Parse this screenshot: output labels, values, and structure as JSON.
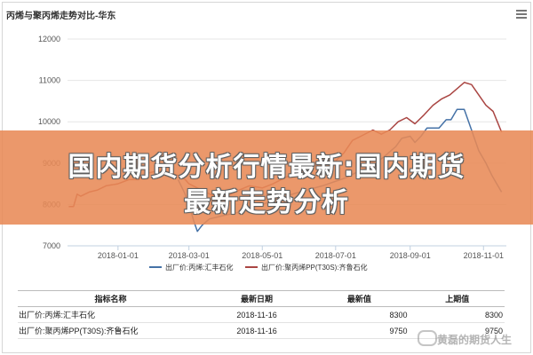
{
  "page": {
    "title": "丙烯与聚丙烯走势对比-华东",
    "banner_line1": "国内期货分析行情最新:国内期货",
    "banner_line2": "最新走势分析",
    "watermark": "黄磊的期货人生"
  },
  "colors": {
    "series1": "#4572a7",
    "series2": "#aa4643",
    "grid": "#e6e6e6",
    "banner": "#e88a56"
  },
  "chart_data": {
    "type": "line",
    "title": "丙烯与聚丙烯走势对比-华东",
    "xlabel": "",
    "ylabel": "",
    "ylim": [
      7000,
      12000
    ],
    "yticks": [
      "12000",
      "11000",
      "10000",
      "9000",
      "8000",
      "7000"
    ],
    "xticks": [
      "2018-01-01",
      "2018-03-01",
      "2018-05-01",
      "2018-07-01",
      "2018-09-01",
      "2018-11-01"
    ],
    "xrange": [
      "2017-11-20",
      "2018-11-20"
    ],
    "grid": true,
    "legend_position": "bottom",
    "series": [
      {
        "name": "出厂价:丙烯:汇丰石化",
        "points": [
          [
            "2018-02-20",
            8600
          ],
          [
            "2018-02-25",
            8300
          ],
          [
            "2018-03-01",
            8000
          ],
          [
            "2018-03-05",
            7600
          ],
          [
            "2018-03-08",
            7350
          ],
          [
            "2018-03-12",
            7500
          ],
          [
            "2018-03-18",
            7650
          ],
          [
            "2018-03-25",
            7700
          ],
          [
            "2018-04-01",
            7750
          ],
          [
            "2018-04-10",
            7800
          ],
          [
            "2018-04-20",
            7900
          ],
          [
            "2018-05-01",
            8000
          ],
          [
            "2018-05-15",
            8150
          ],
          [
            "2018-06-01",
            8300
          ],
          [
            "2018-06-20",
            8450
          ],
          [
            "2018-07-10",
            8650
          ],
          [
            "2018-07-20",
            8800
          ],
          [
            "2018-08-01",
            8950
          ],
          [
            "2018-08-10",
            9150
          ],
          [
            "2018-08-20",
            9400
          ],
          [
            "2018-08-25",
            9600
          ],
          [
            "2018-09-01",
            9650
          ],
          [
            "2018-09-05",
            9500
          ],
          [
            "2018-09-10",
            9650
          ],
          [
            "2018-09-15",
            9850
          ],
          [
            "2018-09-25",
            9850
          ],
          [
            "2018-10-01",
            10050
          ],
          [
            "2018-10-05",
            10050
          ],
          [
            "2018-10-10",
            10300
          ],
          [
            "2018-10-16",
            10300
          ],
          [
            "2018-10-22",
            9800
          ],
          [
            "2018-10-28",
            9300
          ],
          [
            "2018-11-03",
            9000
          ],
          [
            "2018-11-08",
            8700
          ],
          [
            "2018-11-12",
            8500
          ],
          [
            "2018-11-16",
            8300
          ]
        ]
      },
      {
        "name": "出厂价:聚丙烯PP(T30S):齐鲁石化",
        "points": [
          [
            "2017-11-21",
            7950
          ],
          [
            "2017-11-25",
            7950
          ],
          [
            "2017-11-28",
            8250
          ],
          [
            "2017-12-01",
            8200
          ],
          [
            "2017-12-08",
            8300
          ],
          [
            "2017-12-15",
            8350
          ],
          [
            "2017-12-22",
            8450
          ],
          [
            "2018-01-01",
            8500
          ],
          [
            "2018-01-10",
            8600
          ],
          [
            "2018-01-18",
            8600
          ],
          [
            "2018-01-25",
            8750
          ],
          [
            "2018-02-01",
            8800
          ],
          [
            "2018-02-10",
            8800
          ],
          [
            "2018-02-20",
            8700
          ],
          [
            "2018-02-26",
            8600
          ],
          [
            "2018-03-01",
            8500
          ],
          [
            "2018-03-08",
            8400
          ],
          [
            "2018-03-15",
            8300
          ],
          [
            "2018-03-22",
            8200
          ],
          [
            "2018-04-01",
            8200
          ],
          [
            "2018-04-12",
            8350
          ],
          [
            "2018-04-20",
            8450
          ],
          [
            "2018-05-01",
            8400
          ],
          [
            "2018-05-10",
            8500
          ],
          [
            "2018-05-20",
            8650
          ],
          [
            "2018-06-01",
            8800
          ],
          [
            "2018-06-10",
            8900
          ],
          [
            "2018-06-20",
            9000
          ],
          [
            "2018-07-01",
            9050
          ],
          [
            "2018-07-08",
            9250
          ],
          [
            "2018-07-15",
            9550
          ],
          [
            "2018-07-22",
            9650
          ],
          [
            "2018-08-01",
            9800
          ],
          [
            "2018-08-08",
            9700
          ],
          [
            "2018-08-15",
            9800
          ],
          [
            "2018-08-22",
            10000
          ],
          [
            "2018-08-29",
            10100
          ],
          [
            "2018-09-05",
            9950
          ],
          [
            "2018-09-12",
            10150
          ],
          [
            "2018-09-20",
            10400
          ],
          [
            "2018-09-27",
            10550
          ],
          [
            "2018-10-04",
            10650
          ],
          [
            "2018-10-10",
            10800
          ],
          [
            "2018-10-16",
            10950
          ],
          [
            "2018-10-22",
            10900
          ],
          [
            "2018-10-28",
            10650
          ],
          [
            "2018-11-03",
            10400
          ],
          [
            "2018-11-09",
            10250
          ],
          [
            "2018-11-16",
            9750
          ]
        ]
      }
    ]
  },
  "table": {
    "headers": [
      "指标名称",
      "最新日期",
      "最新值",
      "上期值"
    ],
    "rows": [
      [
        "出厂价:丙烯:汇丰石化",
        "2018-11-16",
        "8300",
        "8300"
      ],
      [
        "出厂价:聚丙烯PP(T30S):齐鲁石化",
        "2018-11-16",
        "9750",
        "9750"
      ]
    ]
  }
}
